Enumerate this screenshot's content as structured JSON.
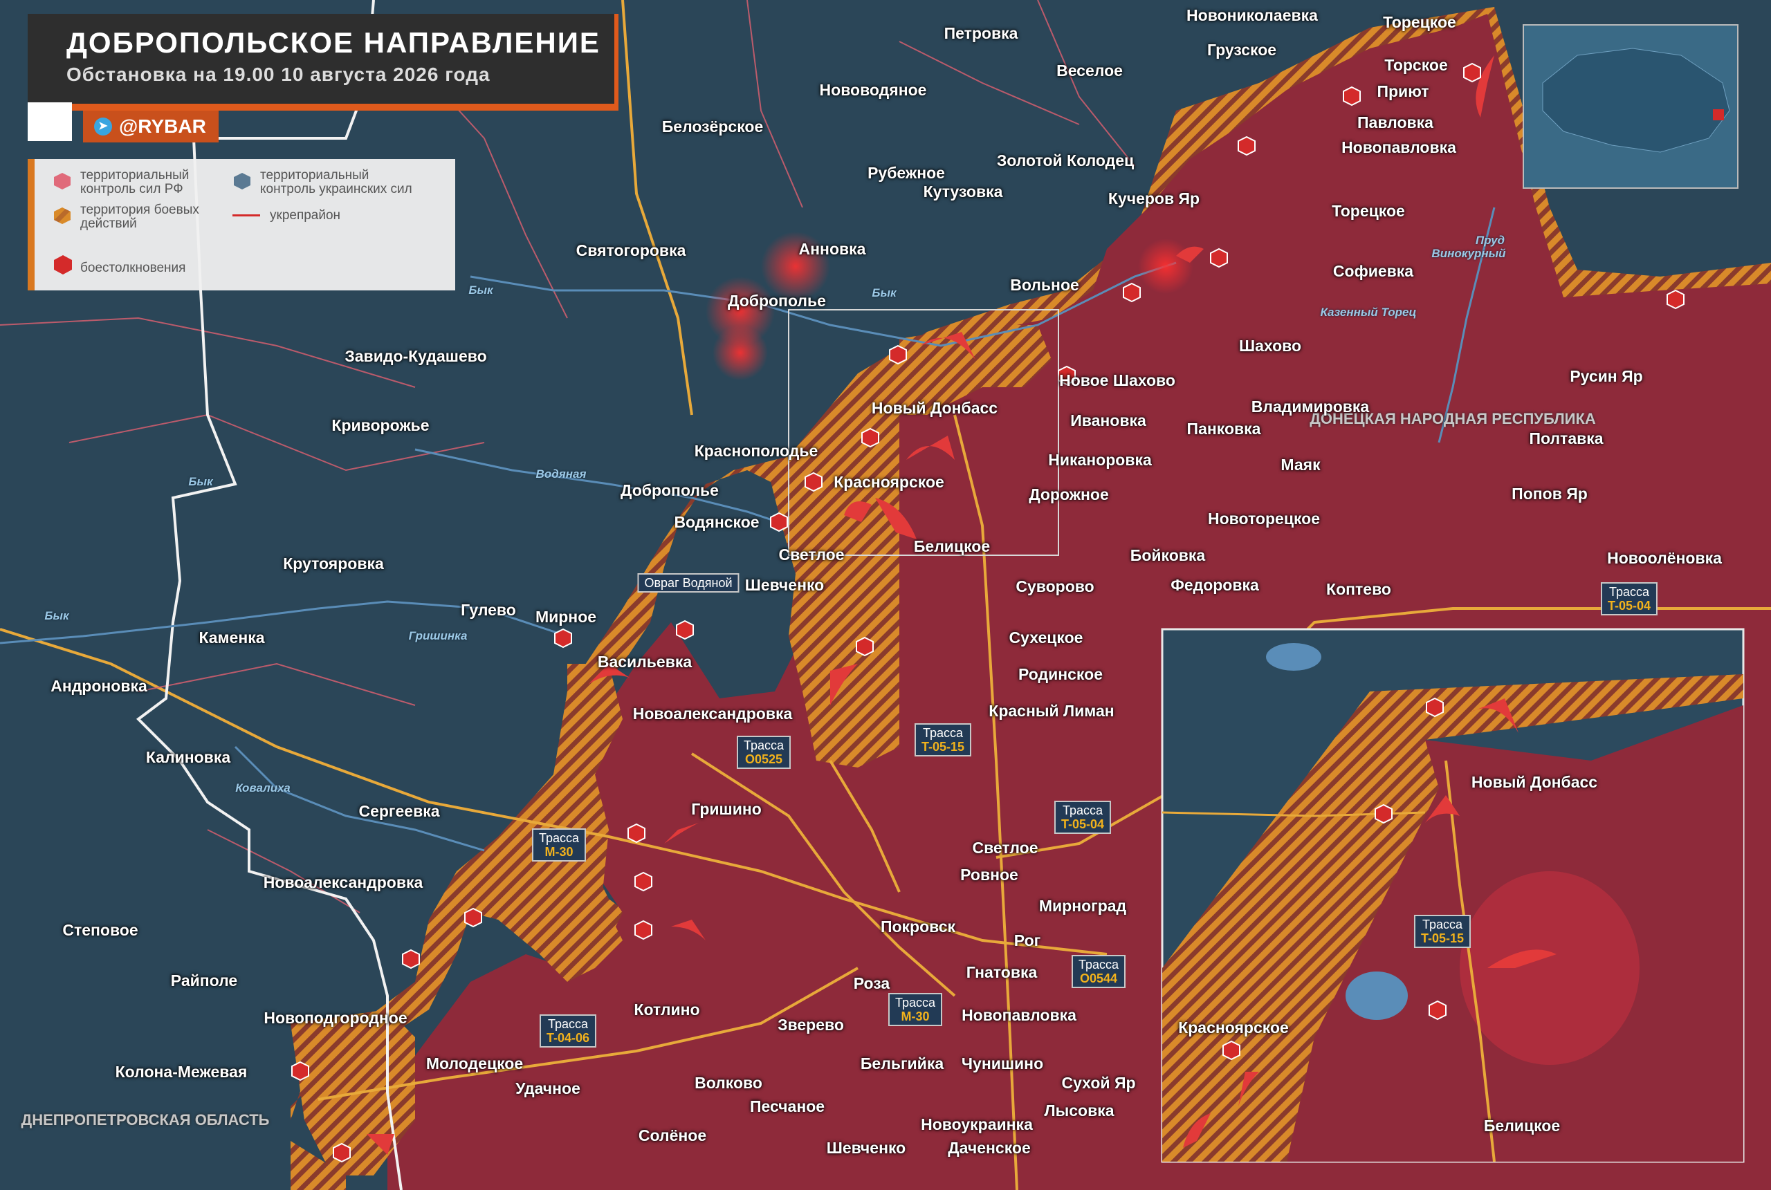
{
  "header": {
    "title": "ДОБРОПОЛЬСКОЕ НАПРАВЛЕНИЕ",
    "subtitle": "Обстановка на 19.00 10 августа 2026 года",
    "channel": "@RYBAR"
  },
  "legend": {
    "ru_control": "территориальный контроль сил РФ",
    "ua_control": "территориальный контроль украинских сил",
    "combat": "территория боевых действий",
    "fortified": "укрепрайон",
    "clashes": "боестолкновения"
  },
  "regions": {
    "dnr": "ДОНЕЦКАЯ НАРОДНАЯ РЕСПУБЛИКА",
    "dnepr": "ДНЕПРОПЕТРОВСКАЯ ОБЛАСТЬ"
  },
  "settlements_ua": [
    "Петровка",
    "Новониколаевка",
    "Грузское",
    "Веселое",
    "Нововодяное",
    "Белозёрское",
    "Золотой Колодец",
    "Рубежное",
    "Кучеров Яр",
    "Кутузовка",
    "Святогоровка",
    "Анновка",
    "Доброполье",
    "Вольное",
    "Завидо-Кудашево",
    "Криворожье",
    "Краснополодье",
    "Доброполье",
    "Крутояровка",
    "Гулево",
    "Каменка",
    "Андроновка",
    "Калиновка",
    "Сергеевка",
    "Степовое",
    "Райполе"
  ],
  "settlements_ru": [
    "Торецкое",
    "Торское",
    "Приют",
    "Павловка",
    "Новопавловка",
    "Торецкое",
    "Софиевка",
    "Шахово",
    "Новое Шахово",
    "Новый Донбасс",
    "Ивановка",
    "Владимировка",
    "Панковка",
    "Маяк",
    "Никаноровка",
    "Красноярское",
    "Дорожное",
    "Водянское",
    "Светлое",
    "Белицкое",
    "Новоторецкое",
    "Бойковка",
    "Федоровка",
    "Коптево",
    "Шевченко",
    "Суворово",
    "Мирное",
    "Сухецкое",
    "Васильевка",
    "Родинское",
    "Новоалександровка",
    "Красный Лиман",
    "Гришино",
    "Светлое",
    "Ровное",
    "Мирноград",
    "Покровск",
    "Рог",
    "Новоалександровка",
    "Роза",
    "Гнатовка",
    "Котлино",
    "Зверево",
    "Новопавловка",
    "Новоподгородное",
    "Молодецкое",
    "Удачное",
    "Бельгийка",
    "Чунишино",
    "Колона-Межевая",
    "Волково",
    "Песчаное",
    "Сухой Яр",
    "Новоукраинка",
    "Лысовка",
    "Солёное",
    "Шевченко",
    "Даченское",
    "Русин Яр",
    "Полтавка",
    "Попов Яр",
    "Новоолёновка"
  ],
  "rivers": [
    "Бык",
    "Бык",
    "Бык",
    "Бык",
    "Водяная",
    "Гришинка",
    "Ковалиха",
    "Винокурный",
    "Пруд",
    "Казенный Торец"
  ],
  "ravine": "Овраг Водяной",
  "highways": [
    {
      "a": "Трасса",
      "b": "O0525"
    },
    {
      "a": "Трасса",
      "b": "T-05-15"
    },
    {
      "a": "Трасса",
      "b": "M-30"
    },
    {
      "a": "Трасса",
      "b": "T-05-04"
    },
    {
      "a": "Трасса",
      "b": "O0544"
    },
    {
      "a": "Трасса",
      "b": "M-30"
    },
    {
      "a": "Трасса",
      "b": "T-04-06"
    },
    {
      "a": "Трасса",
      "b": "T-05-04"
    }
  ],
  "zoom_inset": {
    "highway": {
      "a": "Трасса",
      "b": "T-05-15"
    },
    "labels": [
      "Новый Донбасс",
      "Красноярское",
      "Белицкое"
    ]
  },
  "colors": {
    "ru": "#8e2a3a",
    "ua": "#2c4a5e",
    "combat": "#d98a2a",
    "clash": "#d42a2a",
    "road": "#e8a93a"
  }
}
